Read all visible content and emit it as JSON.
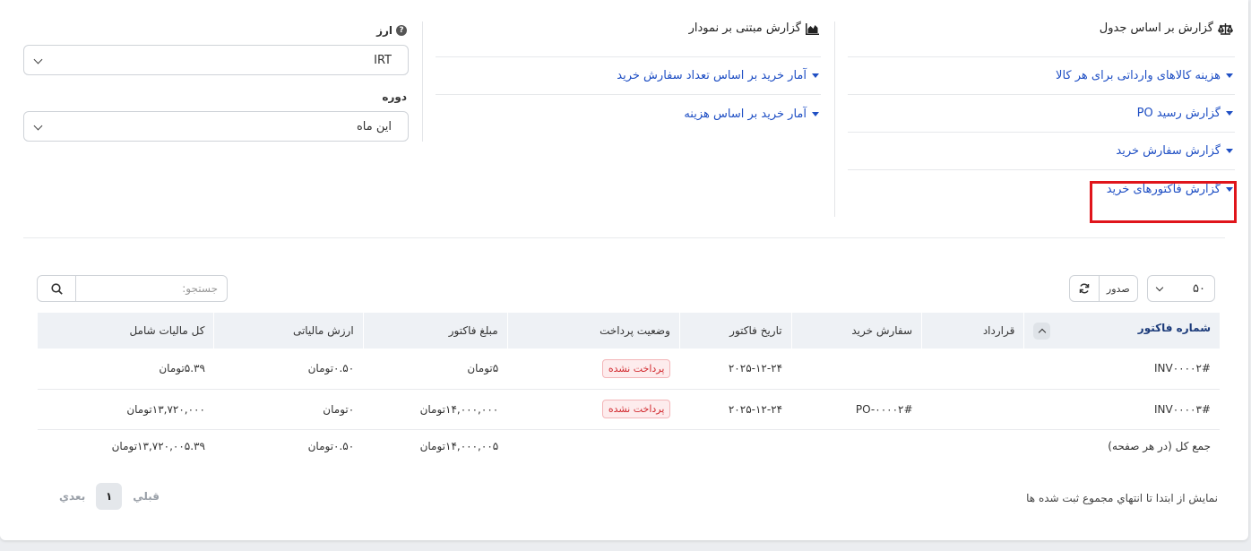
{
  "table_reports": {
    "title": "گزارش بر اساس جدول",
    "items": [
      {
        "label": "هزینه کالاهای وارداتی برای هر کالا"
      },
      {
        "label": "گزارش رسید PO"
      },
      {
        "label": "گزارش سفارش خرید"
      },
      {
        "label": "گزارش فاکتورهای خرید"
      }
    ]
  },
  "chart_reports": {
    "title": "گزارش مبتنی بر نمودار",
    "items": [
      {
        "label": "آمار خرید بر اساس تعداد سفارش خرید"
      },
      {
        "label": "آمار خرید بر اساس هزینه"
      }
    ]
  },
  "filters": {
    "currency_label": "ارز",
    "currency_value": "IRT",
    "period_label": "دوره",
    "period_value": "این ماه"
  },
  "toolbar": {
    "per_page": "۵۰",
    "export_label": "صدور",
    "search_placeholder": "جستجو:"
  },
  "table": {
    "headers": [
      "شماره فاکتور",
      "قرارداد",
      "سفارش خرید",
      "تاریخ فاکتور",
      "وضعیت پرداخت",
      "مبلغ فاکتور",
      "ارزش مالیاتی",
      "کل مالیات شامل"
    ],
    "rows": [
      [
        "INV۰۰۰۰۲#",
        "",
        "",
        "۲۰۲۵-۱۲-۲۴",
        "پرداخت نشده",
        "۵تومان",
        "۰.۵۰تومان",
        "۵.۳۹تومان"
      ],
      [
        "INV۰۰۰۰۳#",
        "",
        "PO-۰۰۰۰۲#",
        "۲۰۲۵-۱۲-۲۴",
        "پرداخت نشده",
        "۱۴,۰۰۰,۰۰۰تومان",
        "۰تومان",
        "۱۳,۷۲۰,۰۰۰تومان"
      ]
    ],
    "total": {
      "label": "جمع کل (در هر صفحه)",
      "amount": "۱۴,۰۰۰,۰۰۵تومان",
      "tax": "۰.۵۰تومان",
      "total_with_tax": "۱۳,۷۲۰,۰۰۵.۳۹تومان"
    }
  },
  "footer": {
    "info": "نمايش از ابتدا تا انتهاي مجموع ثبت شده ها",
    "prev": "قبلي",
    "page": "۱",
    "next": "بعدي"
  }
}
